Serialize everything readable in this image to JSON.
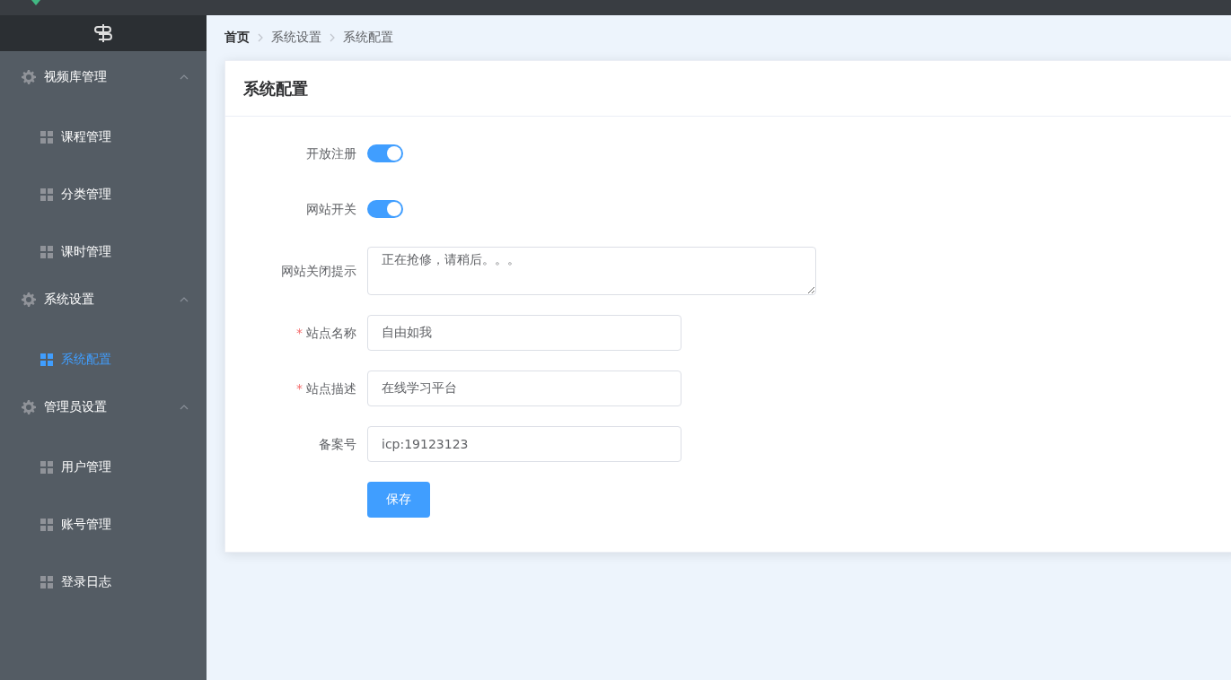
{
  "sidebar": {
    "groups": [
      {
        "label": "视频库管理",
        "expanded": true,
        "items": [
          {
            "label": "课程管理",
            "selected": false
          },
          {
            "label": "分类管理",
            "selected": false
          },
          {
            "label": "课时管理",
            "selected": false
          }
        ]
      },
      {
        "label": "系统设置",
        "expanded": true,
        "items": [
          {
            "label": "系统配置",
            "selected": true
          }
        ]
      },
      {
        "label": "管理员设置",
        "expanded": true,
        "items": [
          {
            "label": "用户管理",
            "selected": false
          },
          {
            "label": "账号管理",
            "selected": false
          },
          {
            "label": "登录日志",
            "selected": false
          }
        ]
      }
    ]
  },
  "breadcrumb": [
    {
      "label": "首页",
      "bold": true
    },
    {
      "label": "系统设置",
      "bold": false
    },
    {
      "label": "系统配置",
      "bold": false
    }
  ],
  "card": {
    "title": "系统配置"
  },
  "form": {
    "fields": [
      {
        "kind": "switch",
        "label": "开放注册",
        "on": true
      },
      {
        "kind": "switch",
        "label": "网站开关",
        "on": true
      },
      {
        "kind": "textarea",
        "label": "网站关闭提示",
        "value": "正在抢修，请稍后。。。"
      },
      {
        "kind": "input",
        "label": "站点名称",
        "required_mark": "*",
        "value": "自由如我"
      },
      {
        "kind": "input",
        "label": "站点描述",
        "required_mark": "*",
        "value": "在线学习平台"
      },
      {
        "kind": "input",
        "label": "备案号",
        "value": "icp:19123123"
      }
    ],
    "submit": "保存"
  }
}
